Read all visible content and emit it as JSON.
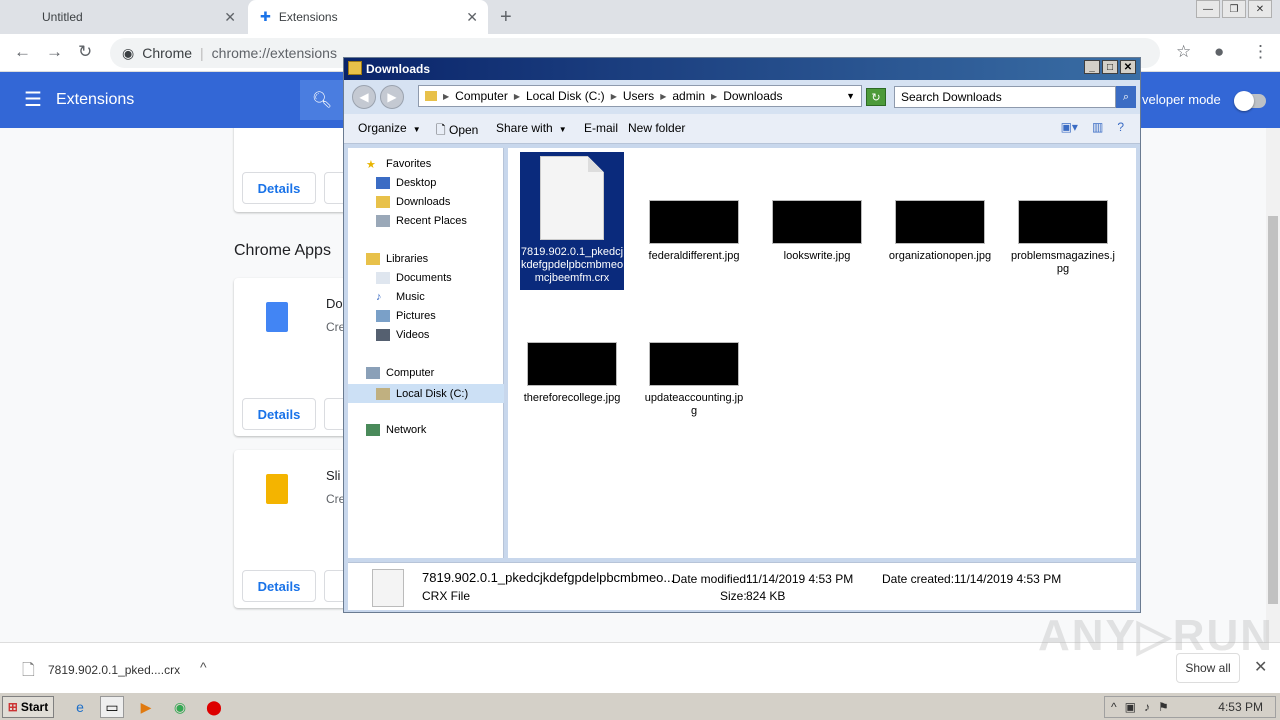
{
  "chrome": {
    "tabs": [
      {
        "title": "Untitled"
      },
      {
        "title": "Extensions"
      }
    ],
    "omnibox": {
      "site": "Chrome",
      "url": "chrome://extensions"
    }
  },
  "extensions_page": {
    "header_title": "Extensions",
    "dev_mode_label": "veloper mode",
    "section_title": "Chrome Apps",
    "details_label": "Details",
    "cards": [
      {
        "name": "Do",
        "desc": "Cre"
      },
      {
        "name": "Sli",
        "desc": "Cre"
      }
    ]
  },
  "download_bar": {
    "filename": "7819.902.0.1_pked....crx",
    "show_all": "Show all"
  },
  "explorer": {
    "title": "Downloads",
    "breadcrumb": [
      "Computer",
      "Local Disk (C:)",
      "Users",
      "admin",
      "Downloads"
    ],
    "search_placeholder": "Search Downloads",
    "commands": {
      "organize": "Organize",
      "open": "Open",
      "share": "Share with",
      "email": "E-mail",
      "newfolder": "New folder"
    },
    "nav": {
      "favorites": "Favorites",
      "desktop": "Desktop",
      "downloads": "Downloads",
      "recent": "Recent Places",
      "libraries": "Libraries",
      "documents": "Documents",
      "music": "Music",
      "pictures": "Pictures",
      "videos": "Videos",
      "computer": "Computer",
      "localdisk": "Local Disk (C:)",
      "network": "Network"
    },
    "files": [
      {
        "name": "7819.902.0.1_pkedcjkdefgpdelpbcmbmeomcjbeemfm.crx"
      },
      {
        "name": "federaldifferent.jpg"
      },
      {
        "name": "lookswrite.jpg"
      },
      {
        "name": "organizationopen.jpg"
      },
      {
        "name": "problemsmagazines.jpg"
      },
      {
        "name": "thereforecollege.jpg"
      },
      {
        "name": "updateaccounting.jpg"
      }
    ],
    "details": {
      "name": "7819.902.0.1_pkedcjkdefgpdelpbcmbmeo...",
      "type": "CRX File",
      "modified_label": "Date modified:",
      "modified": "11/14/2019 4:53 PM",
      "created_label": "Date created:",
      "created": "11/14/2019 4:53 PM",
      "size_label": "Size:",
      "size": "824 KB"
    }
  },
  "taskbar": {
    "start": "Start",
    "clock": "4:53 PM"
  }
}
